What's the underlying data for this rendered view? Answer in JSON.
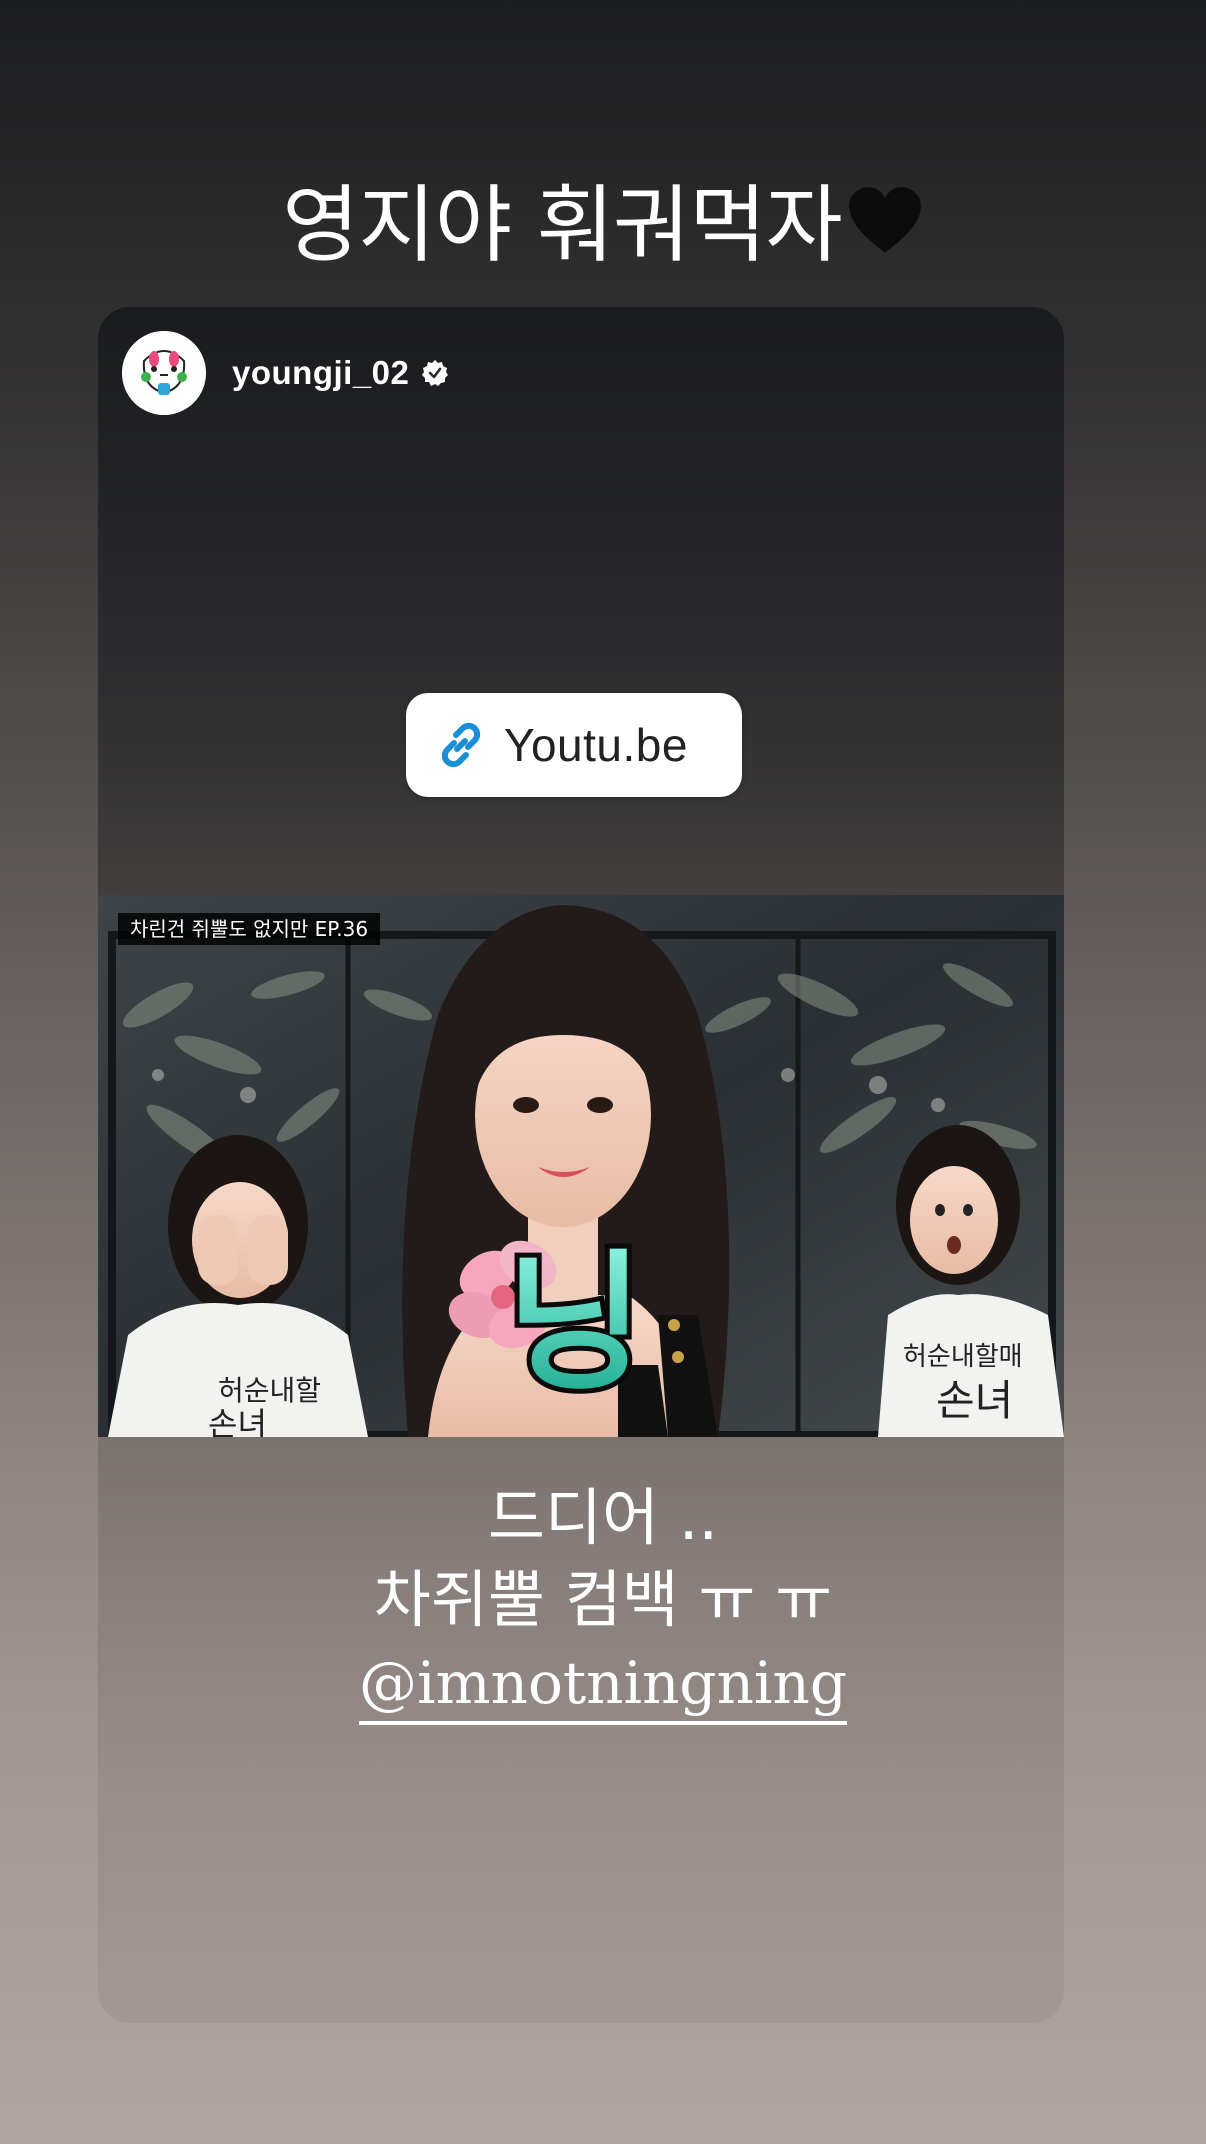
{
  "story": {
    "caption": "영지야 훠궈먹자",
    "caption_emoji": "black-heart-emoji"
  },
  "post": {
    "username": "youngji_02",
    "verified": true,
    "link_sticker": {
      "icon": "link-icon",
      "label": "Youtu.be"
    },
    "video_thumbnail": {
      "series_label": "차린건 쥐뿔도 없지만 EP.36",
      "title_glyph": "닝",
      "shirt_text": "허순내할매손녀"
    }
  },
  "text_overlay": {
    "line1": "드디어 ..",
    "line2": "차쥐뿔 컴백 ㅠ ㅠ",
    "mention": "@imnotningning"
  },
  "colors": {
    "link_icon": "#1a8fd6",
    "sticker_bg": "#ffffff",
    "title_glyph_fill": "#5fe0c8"
  }
}
